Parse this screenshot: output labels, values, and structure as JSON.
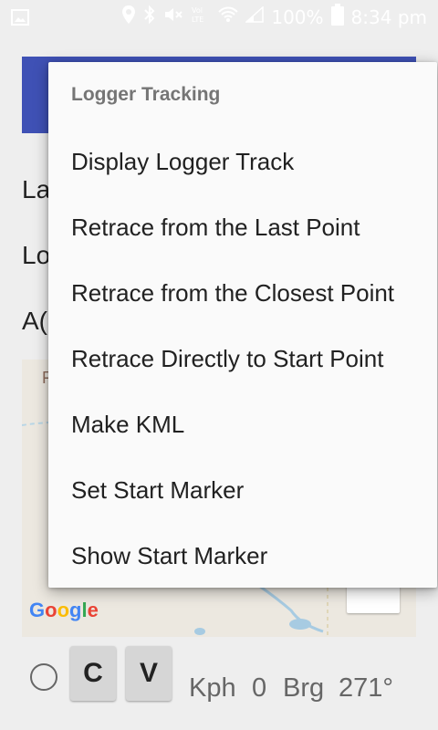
{
  "status_bar": {
    "battery_text": "100%",
    "time": "8:34 pm",
    "icons": [
      "image-icon",
      "location-icon",
      "bluetooth-icon",
      "mute-icon",
      "volte-icon",
      "wifi-icon",
      "signal-icon",
      "battery-icon"
    ],
    "volte_label": "Vol\nLTE"
  },
  "background": {
    "app_bar_color": "#3f51b5",
    "labels": [
      "La",
      "Lo",
      "A("
    ],
    "map_letter": "F",
    "google_logo": "Google",
    "zoom_out_icon": "minus-icon"
  },
  "controls": {
    "c_label": "C",
    "v_label": "V",
    "speed_unit": "Kph",
    "speed_value": "0",
    "bearing_label": "Brg",
    "bearing_value": "271°"
  },
  "menu": {
    "header": "Logger Tracking",
    "items": [
      "Display Logger Track",
      "Retrace from the Last Point",
      "Retrace from the Closest Point",
      "Retrace Directly to Start Point",
      "Make KML",
      "Set Start Marker",
      "Show Start Marker"
    ]
  }
}
